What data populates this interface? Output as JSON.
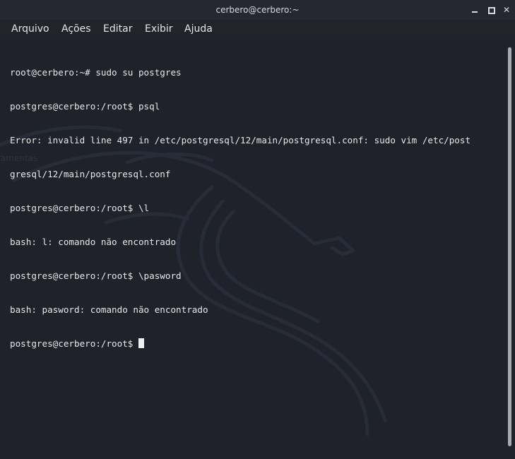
{
  "window": {
    "title": "cerbero@cerbero:~"
  },
  "menu": {
    "items": [
      "Arquivo",
      "Ações",
      "Editar",
      "Exibir",
      "Ajuda"
    ]
  },
  "terminal": {
    "lines": [
      "root@cerbero:~# sudo su postgres",
      "postgres@cerbero:/root$ psql",
      "Error: invalid line 497 in /etc/postgresql/12/main/postgresql.conf: sudo vim /etc/post",
      "gresql/12/main/postgresql.conf",
      "postgres@cerbero:/root$ \\l",
      "bash: l: comando não encontrado",
      "postgres@cerbero:/root$ \\pasword",
      "bash: pasword: comando não encontrado",
      "postgres@cerbero:/root$ "
    ]
  },
  "colors": {
    "terminal_background": "#1f222a",
    "titlebar": "#252830",
    "text": "#e6e8ea"
  },
  "icons": [
    "minimize-icon",
    "maximize-icon",
    "close-icon"
  ]
}
